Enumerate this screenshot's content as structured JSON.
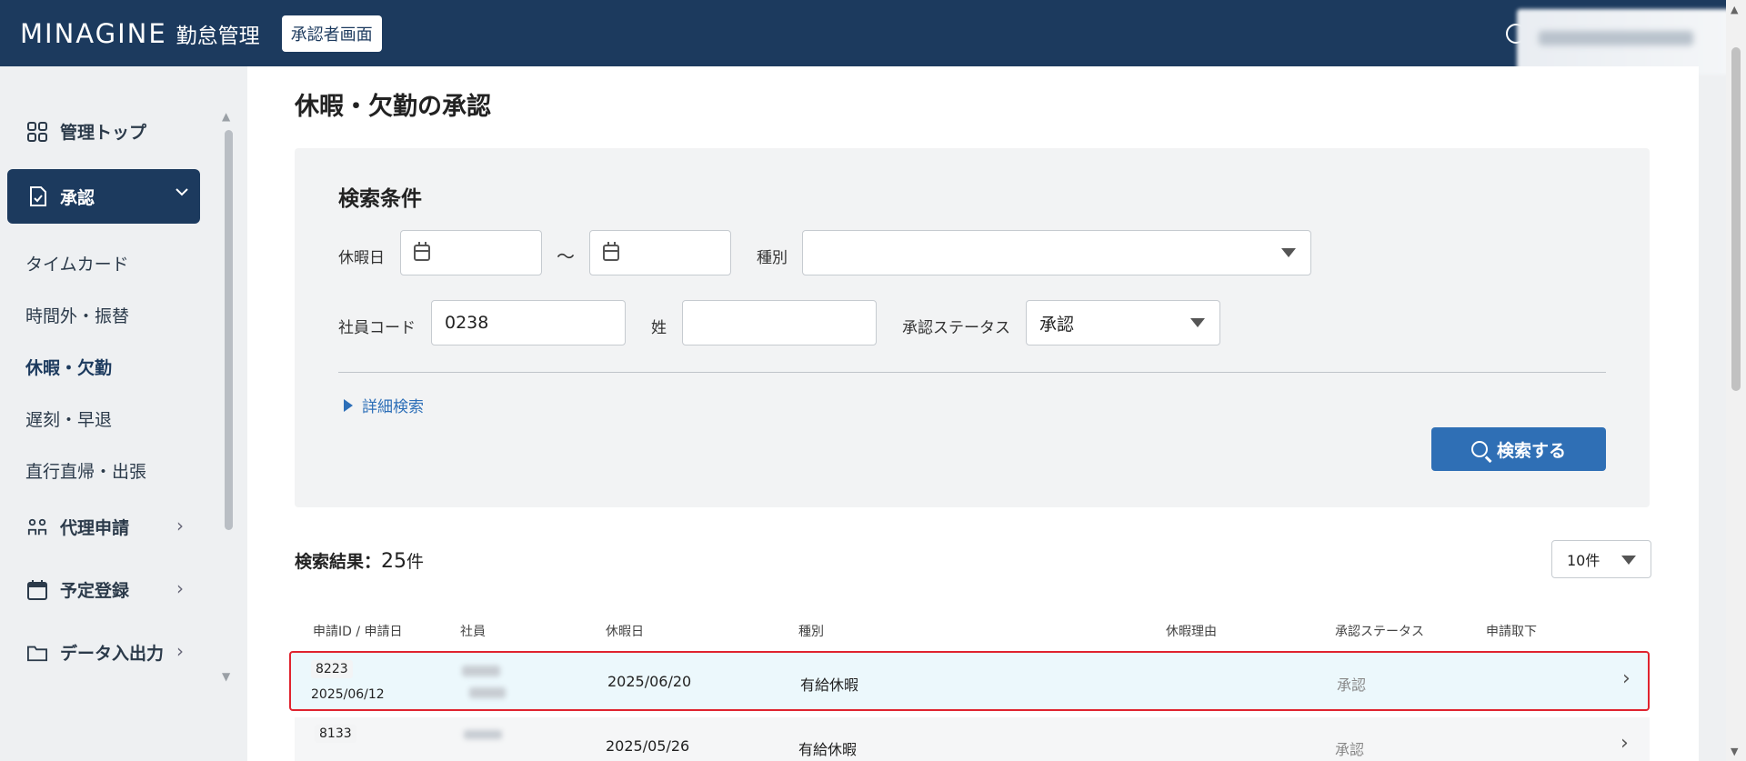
{
  "header": {
    "logo": "MINAGINE",
    "logo_sub": "勤怠管理",
    "role_badge": "承認者画面"
  },
  "sidebar": {
    "items": [
      {
        "label": "管理トップ",
        "icon": "grid-icon"
      },
      {
        "label": "承認",
        "icon": "document-check-icon"
      }
    ],
    "sub_items": [
      "タイムカード",
      "時間外・振替",
      "休暇・欠勤",
      "遅刻・早退",
      "直行直帰・出張"
    ],
    "more_items": [
      {
        "label": "代理申請",
        "icon": "people-icon"
      },
      {
        "label": "予定登録",
        "icon": "calendar-icon"
      },
      {
        "label": "データ入出力",
        "icon": "folder-icon"
      }
    ]
  },
  "main": {
    "title": "休暇・欠勤の承認",
    "search": {
      "panel_title": "検索条件",
      "holiday_label": "休暇日",
      "tilde": "〜",
      "type_label": "種別",
      "type_value": "",
      "employee_code_label": "社員コード",
      "employee_code_value": "0238",
      "last_name_label": "姓",
      "last_name_value": "",
      "status_label": "承認ステータス",
      "status_value": "承認",
      "advanced_link": "詳細検索",
      "search_button": "検索する"
    },
    "results": {
      "label": "検索結果：",
      "count": "25",
      "unit": "件",
      "page_size": "10件",
      "columns": [
        "申請ID / 申請日",
        "社員",
        "休暇日",
        "種別",
        "休暇理由",
        "承認ステータス",
        "申請取下"
      ],
      "rows": [
        {
          "id": "8223",
          "applied": "2025/06/12",
          "holiday": "2025/06/20",
          "type": "有給休暇",
          "status": "承認"
        },
        {
          "id": "8133",
          "applied": "",
          "holiday": "2025/05/26",
          "type": "有給休暇",
          "status": "承認"
        }
      ]
    }
  },
  "colors": {
    "header_bg": "#1c3a5e",
    "primary_button": "#2f6fb5",
    "selected_row_border": "#e0242f",
    "selected_row_bg": "#ecf8fc"
  }
}
